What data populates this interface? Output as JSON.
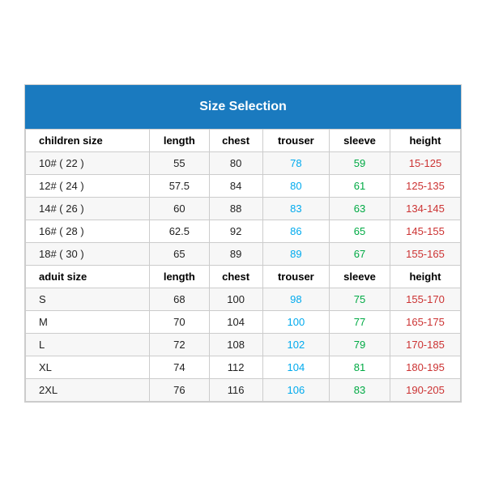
{
  "title": "Size Selection",
  "columns": [
    "children size",
    "length",
    "chest",
    "trouser",
    "sleeve",
    "height"
  ],
  "children_rows": [
    {
      "size": "10# ( 22 )",
      "length": "55",
      "chest": "80",
      "trouser": "78",
      "sleeve": "59",
      "height": "15-125"
    },
    {
      "size": "12# ( 24 )",
      "length": "57.5",
      "chest": "84",
      "trouser": "80",
      "sleeve": "61",
      "height": "125-135"
    },
    {
      "size": "14# ( 26 )",
      "length": "60",
      "chest": "88",
      "trouser": "83",
      "sleeve": "63",
      "height": "134-145"
    },
    {
      "size": "16# ( 28 )",
      "length": "62.5",
      "chest": "92",
      "trouser": "86",
      "sleeve": "65",
      "height": "145-155"
    },
    {
      "size": "18# ( 30 )",
      "length": "65",
      "chest": "89",
      "trouser": "89",
      "sleeve": "67",
      "height": "155-165"
    }
  ],
  "adult_columns": [
    "aduit size",
    "length",
    "chest",
    "trouser",
    "sleeve",
    "height"
  ],
  "adult_rows": [
    {
      "size": "S",
      "length": "68",
      "chest": "100",
      "trouser": "98",
      "sleeve": "75",
      "height": "155-170"
    },
    {
      "size": "M",
      "length": "70",
      "chest": "104",
      "trouser": "100",
      "sleeve": "77",
      "height": "165-175"
    },
    {
      "size": "L",
      "length": "72",
      "chest": "108",
      "trouser": "102",
      "sleeve": "79",
      "height": "170-185"
    },
    {
      "size": "XL",
      "length": "74",
      "chest": "112",
      "trouser": "104",
      "sleeve": "81",
      "height": "180-195"
    },
    {
      "size": "2XL",
      "length": "76",
      "chest": "116",
      "trouser": "106",
      "sleeve": "83",
      "height": "190-205"
    }
  ]
}
